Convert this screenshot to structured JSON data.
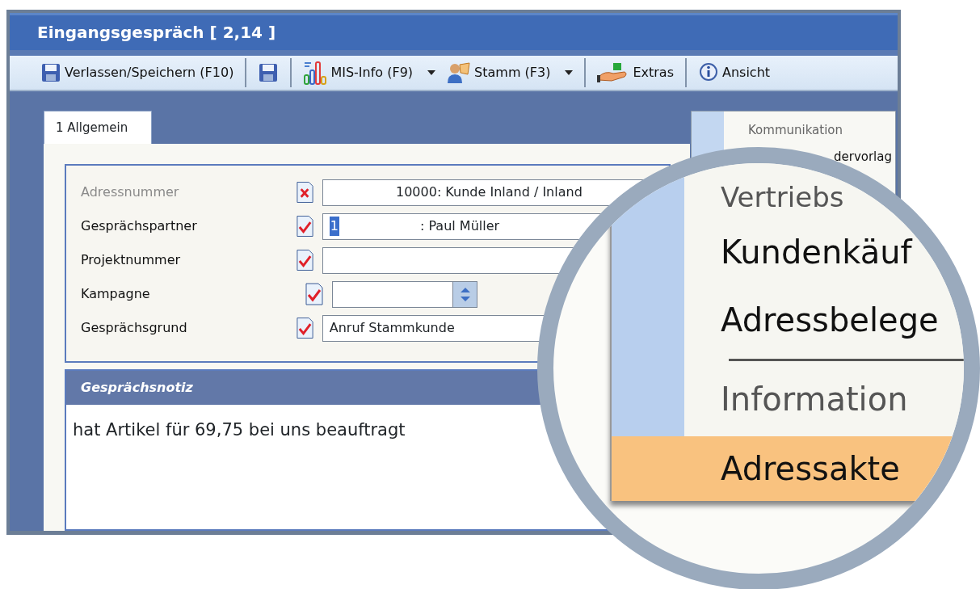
{
  "window": {
    "title": "Eingangsgespräch [ 2,14 ]"
  },
  "toolbar": [
    {
      "kind": "save",
      "label": "Verlassen/Speichern (F10)",
      "dropdown": false
    },
    {
      "kind": "separator"
    },
    {
      "kind": "save",
      "dropdown": false
    },
    {
      "kind": "separator"
    },
    {
      "kind": "chart",
      "label": "MIS-Info (F9)",
      "dropdown": true
    },
    {
      "kind": "person",
      "label": "Stamm (F3)",
      "dropdown": true
    },
    {
      "kind": "separator"
    },
    {
      "kind": "hand",
      "label": "Extras",
      "dropdown": false
    },
    {
      "kind": "separator"
    },
    {
      "kind": "info",
      "label": "Ansicht",
      "dropdown": false
    }
  ],
  "tabs": [
    {
      "label": "1 Allgemein",
      "selected": true
    }
  ],
  "fields": [
    {
      "label": "Adressnummer",
      "disabled": true,
      "valid": false,
      "kind": "centered",
      "value": "10000: Kunde Inland / Inland"
    },
    {
      "label": "Gesprächspartner",
      "disabled": false,
      "valid": true,
      "kind": "code",
      "code": "1",
      "code_selected": true,
      "value": ": Paul Müller"
    },
    {
      "label": "Projektnummer",
      "disabled": false,
      "valid": true,
      "kind": "text"
    },
    {
      "label": "Kampagne",
      "disabled": false,
      "valid": true,
      "kind": "spinner"
    },
    {
      "label": "Gesprächsgrund",
      "disabled": false,
      "valid": true,
      "kind": "text",
      "value": "Anruf Stammkunde"
    }
  ],
  "notes": {
    "title": "Gesprächsnotiz",
    "text": "hat Artikel für 69,75 bei uns beauftragt"
  },
  "menu": {
    "items": [
      {
        "label": "Kommunikation",
        "disabled": true
      },
      {
        "label": "dervorlag",
        "disabled": false
      }
    ]
  },
  "magnifier": {
    "items": [
      {
        "kind": "item",
        "label": "Vertriebs",
        "disabled": true,
        "selected": false
      },
      {
        "kind": "item",
        "label": "Kundenkäuf",
        "disabled": false,
        "selected": false
      },
      {
        "kind": "item",
        "label": "Adressbelege",
        "disabled": false,
        "selected": false
      },
      {
        "kind": "separator"
      },
      {
        "kind": "item",
        "label": "Information",
        "disabled": true,
        "selected": false
      },
      {
        "kind": "item",
        "label": "Adressakte",
        "disabled": false,
        "selected": true
      }
    ]
  }
}
